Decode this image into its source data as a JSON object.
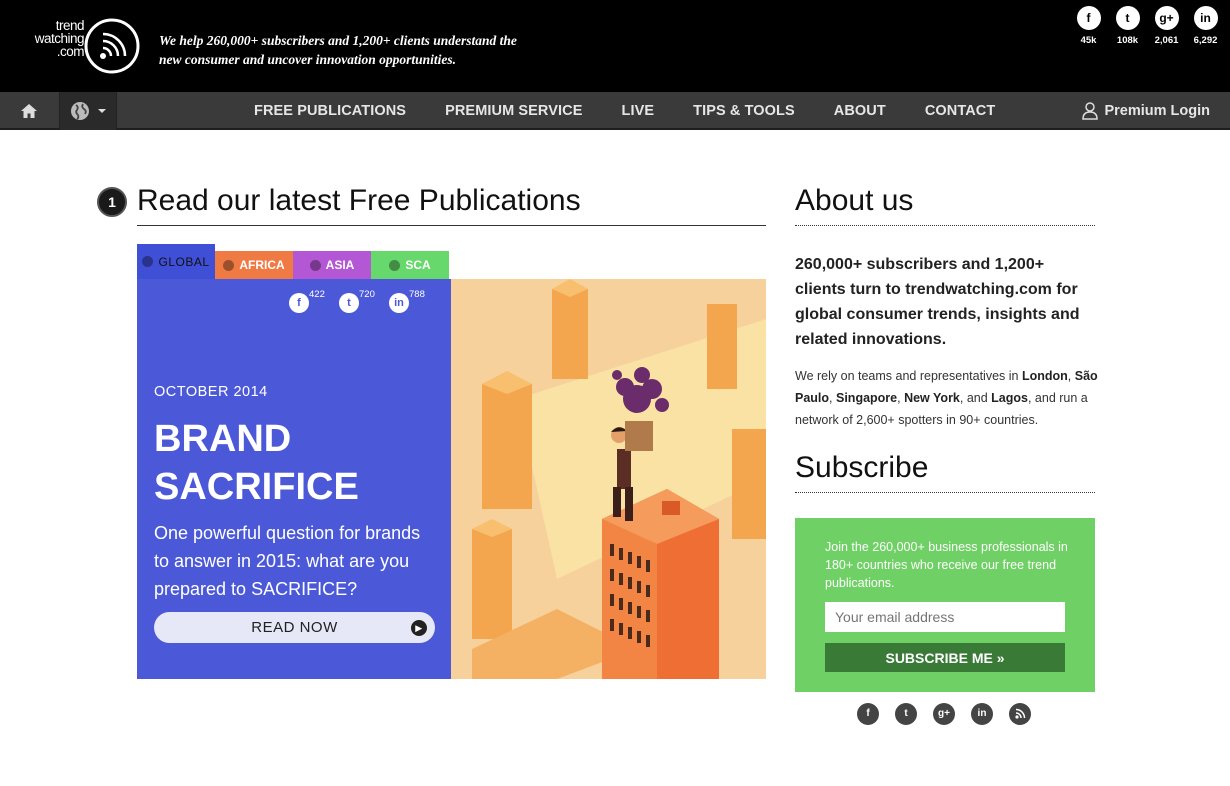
{
  "logo": {
    "line1": "trend",
    "line2": "watching",
    "line3": ".com"
  },
  "tagline": "We help 260,000+ subscribers and 1,200+ clients understand the new consumer and uncover innovation opportunities.",
  "top_social": [
    {
      "icon": "facebook-icon",
      "glyph": "f",
      "count": "45k"
    },
    {
      "icon": "twitter-icon",
      "glyph": "t",
      "count": "108k"
    },
    {
      "icon": "googleplus-icon",
      "glyph": "g+",
      "count": "2,061"
    },
    {
      "icon": "linkedin-icon",
      "glyph": "in",
      "count": "6,292"
    }
  ],
  "nav": {
    "items": [
      "FREE PUBLICATIONS",
      "PREMIUM SERVICE",
      "LIVE",
      "TIPS & TOOLS",
      "ABOUT",
      "CONTACT"
    ],
    "login": "Premium Login"
  },
  "publications": {
    "number": "1",
    "title": "Read our latest Free Publications",
    "tabs": [
      "GLOBAL",
      "AFRICA",
      "ASIA",
      "SCA"
    ],
    "shares": [
      {
        "icon": "facebook-icon",
        "glyph": "f",
        "count": "422"
      },
      {
        "icon": "twitter-icon",
        "glyph": "t",
        "count": "720"
      },
      {
        "icon": "linkedin-icon",
        "glyph": "in",
        "count": "788"
      }
    ],
    "date": "OCTOBER 2014",
    "title_line1": "BRAND",
    "title_line2": "SACRIFICE",
    "description": "One powerful question for brands to answer in 2015: what are you prepared to SACRIFICE?",
    "button": "READ NOW"
  },
  "about": {
    "title": "About us",
    "lead": "260,000+ subscribers and 1,200+ clients turn to trendwatching.com for global consumer trends, insights and related innovations.",
    "body_pre": "We rely on teams and representatives in ",
    "cities": [
      "London",
      "São Paulo",
      "Singapore",
      "New York",
      "Lagos"
    ],
    "body_post": ", and run a network of 2,600+ spotters in 90+ countries."
  },
  "subscribe": {
    "title": "Subscribe",
    "text": "Join the 260,000+ business professionals in 180+ countries who receive our free trend publications.",
    "placeholder": "Your email address",
    "button": "SUBSCRIBE ME »"
  },
  "footer_social": [
    "f",
    "t",
    "g+",
    "in",
    "rss"
  ],
  "colors": {
    "header": "#000000",
    "nav": "#3a3a3a",
    "feature_panel": "#4b59d8",
    "subscribe_box": "#6fd065",
    "subscribe_button": "#3a7a37"
  }
}
